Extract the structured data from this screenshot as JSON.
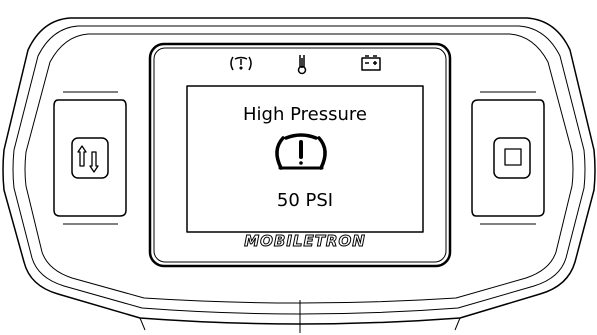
{
  "screen": {
    "status_icons": [
      "tire-pressure-icon",
      "thermometer-icon",
      "battery-icon"
    ],
    "title": "High Pressure",
    "main_icon": "tire-pressure-warning-icon",
    "value": "50 PSI"
  },
  "device": {
    "brand": "MOBILETRON",
    "left_button_icon": "swap-arrows-icon",
    "right_button_icon": "square-icon"
  },
  "colors": {
    "outline": "#000000",
    "background": "#ffffff"
  }
}
